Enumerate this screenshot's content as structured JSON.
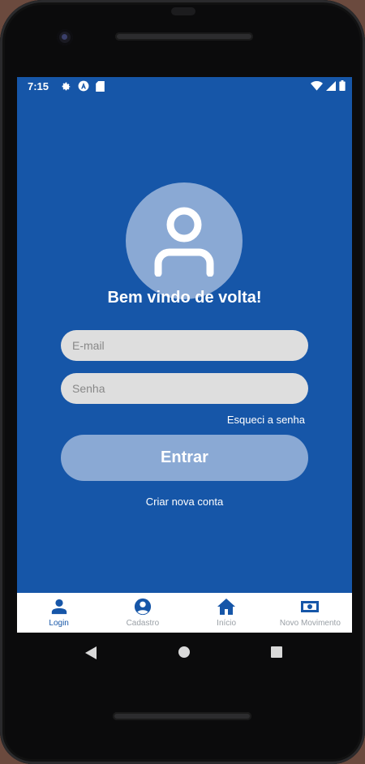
{
  "status": {
    "time": "7:15",
    "left_icons": [
      "gear-icon",
      "android-a-icon",
      "sd-card-icon"
    ],
    "right_icons": [
      "wifi-icon",
      "signal-icon",
      "battery-icon"
    ]
  },
  "login": {
    "welcome": "Bem vindo de volta!",
    "email_placeholder": "E-mail",
    "password_placeholder": "Senha",
    "forgot": "Esqueci a senha",
    "enter": "Entrar",
    "create_account": "Criar nova conta"
  },
  "tabs": [
    {
      "label": "Login",
      "icon": "person-icon",
      "active": true
    },
    {
      "label": "Cadastro",
      "icon": "account-circle-icon",
      "active": false
    },
    {
      "label": "Início",
      "icon": "home-icon",
      "active": false
    },
    {
      "label": "Novo Movimento",
      "icon": "money-icon",
      "active": false
    }
  ],
  "colors": {
    "primary": "#1656a8",
    "light_accent": "#8aa9d4",
    "input_bg": "#dedede",
    "inactive_tab": "#9aa0a6"
  }
}
